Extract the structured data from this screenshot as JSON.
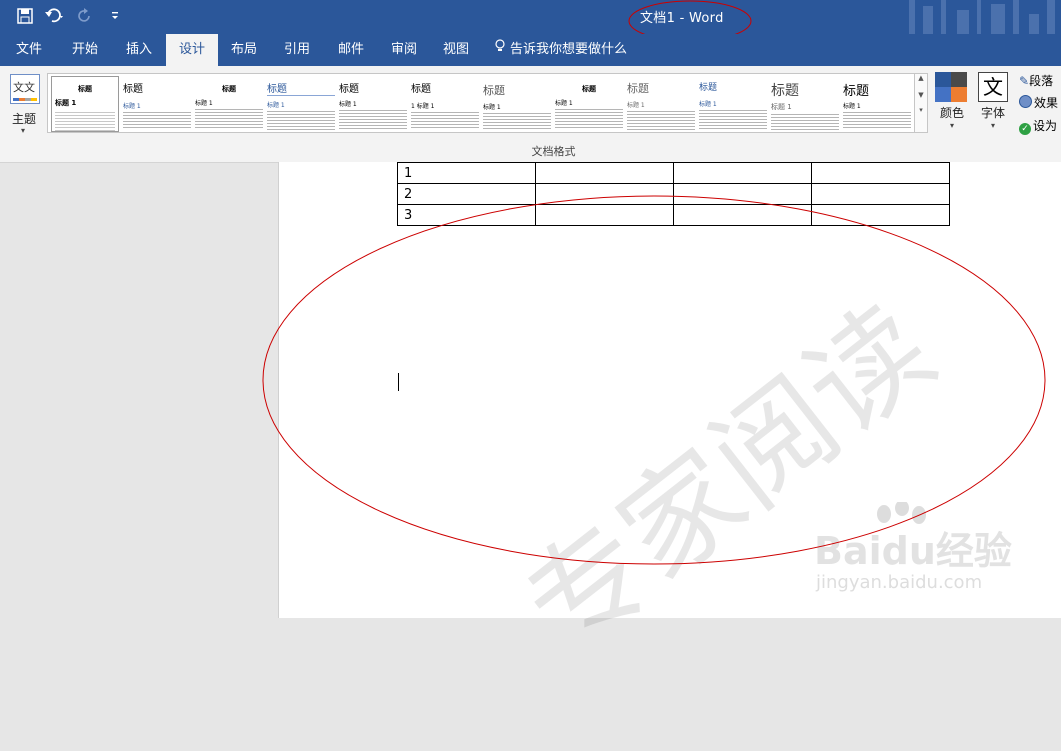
{
  "window": {
    "title": "文档1 - Word"
  },
  "quick_access": {
    "save": "save-icon",
    "undo": "undo-icon",
    "redo": "redo-icon",
    "customize": "customize-icon"
  },
  "ribbon_tabs": [
    "文件",
    "开始",
    "插入",
    "设计",
    "布局",
    "引用",
    "邮件",
    "审阅",
    "视图"
  ],
  "active_tab": "设计",
  "tell_me": "告诉我你想要做什么",
  "design": {
    "themes_label": "主题",
    "theme_icon_text": "文文",
    "styles": [
      {
        "title": "标题",
        "heading": "标题 1"
      },
      {
        "title": "标题",
        "heading": "标题 1"
      },
      {
        "title": "标题",
        "heading": "标题 1"
      },
      {
        "title": "标题",
        "heading": "标题 1"
      },
      {
        "title": "标题",
        "heading": "标题 1"
      },
      {
        "title": "标题",
        "heading": "1 标题 1"
      },
      {
        "title": "标题",
        "heading": "标题 1"
      },
      {
        "title": "标题",
        "heading": "标题 1"
      },
      {
        "title": "标题",
        "heading": "标题 1"
      },
      {
        "title": "标题",
        "heading": "标题 1"
      },
      {
        "title": "标题",
        "heading": "标题 1"
      },
      {
        "title": "标题",
        "heading": "标题 1"
      }
    ],
    "colors_label": "颜色",
    "fonts_label": "字体",
    "fonts_icon_text": "文",
    "paragraph_spacing": "段落",
    "effects": "效果",
    "set_default": "设为",
    "group_label": "文档格式"
  },
  "document": {
    "table_rows": [
      [
        "1",
        "",
        "",
        ""
      ],
      [
        "2",
        "",
        "",
        ""
      ],
      [
        "3",
        "",
        "",
        ""
      ]
    ]
  },
  "watermark": {
    "logo": "Baidu经验",
    "url": "jingyan.baidu.com",
    "calligraphy": "专家阅读"
  },
  "colors": {
    "brand": "#2b579a",
    "annotation": "#cc0000"
  }
}
